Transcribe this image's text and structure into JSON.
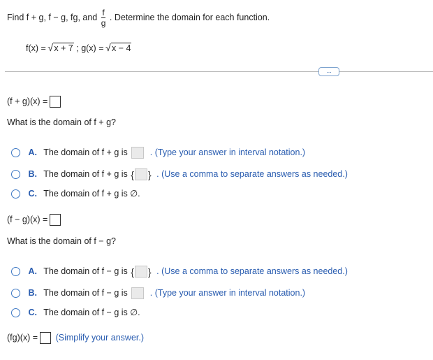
{
  "question": {
    "find_text": "Find f + g, f − g, fg, and",
    "frac_num": "f",
    "frac_den": "g",
    "determine_text": ". Determine the domain for each function.",
    "f_def": "f(x) =",
    "f_radicand": "x + 7",
    "g_def": "; g(x) =",
    "g_radicand": "x − 4"
  },
  "more_button": "...",
  "sum": {
    "expr": "(f + g)(x) =",
    "domain_question": "What is the domain of f + g?",
    "options": [
      {
        "letter": "A.",
        "text": "The domain of f + g is",
        "hint": ". (Type your answer in interval notation.)"
      },
      {
        "letter": "B.",
        "text": "The domain of f + g is",
        "hint": ". (Use a comma to separate answers as needed.)"
      },
      {
        "letter": "C.",
        "text": "The domain of f + g is ∅."
      }
    ]
  },
  "difference": {
    "expr": "(f − g)(x) =",
    "domain_question": "What is the domain of f − g?",
    "options": [
      {
        "letter": "A.",
        "text": "The domain of f − g is",
        "hint": ". (Use a comma to separate answers as needed.)"
      },
      {
        "letter": "B.",
        "text": "The domain of f − g is",
        "hint": ". (Type your answer in interval notation.)"
      },
      {
        "letter": "C.",
        "text": "The domain of f − g is ∅."
      }
    ]
  },
  "product": {
    "expr": "(fg)(x) =",
    "hint": "(Simplify your answer.)"
  },
  "brace_open": "{",
  "brace_close": "}"
}
